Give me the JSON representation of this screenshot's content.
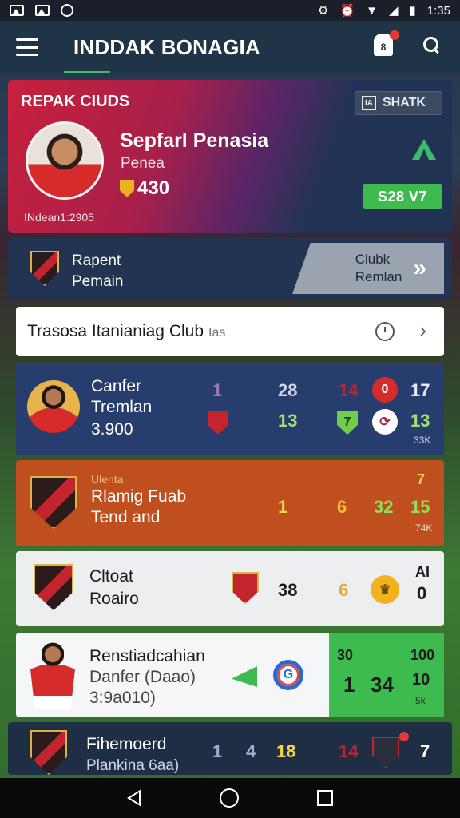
{
  "status_bar": {
    "time": "1:35"
  },
  "app_bar": {
    "title": "INDDAK BONAGIA"
  },
  "hero": {
    "league": "REPAK CIUDS",
    "chip_label": "SHATK",
    "player_name": "Sepfarl Penasia",
    "player_sub": "Penea",
    "points": "430",
    "id_text": "INdean1:2905",
    "badge": "S28 V7",
    "colors": {
      "accent_green": "#3dbb4f",
      "hero_red": "#c8203c"
    }
  },
  "club": {
    "name_line1": "Rapent",
    "name_line2": "Pemain",
    "link_line1": "Clubk",
    "link_line2": "Remlan"
  },
  "search": {
    "text": "Trasosa Itanianiag Club",
    "muted": "Ias"
  },
  "cards": {
    "blue": {
      "name_line1": "Canfer",
      "name_line2": "Tremlan",
      "value": "3.900",
      "n1": "1",
      "n2": "28",
      "n3": "13",
      "n4": "14",
      "n5": "0",
      "n6": "7",
      "n7": "17",
      "n8": "13",
      "n9": "33K"
    },
    "orange": {
      "tag": "Ulenta",
      "name_line1": "Rlamig Fuab",
      "name_line2": "Tend and",
      "n1": "1",
      "n2": "6",
      "n3": "32",
      "n4": "15",
      "top": "7",
      "small": "74K"
    },
    "grey": {
      "name_line1": "Cltoat",
      "name_line2": "Roairo",
      "n1": "38",
      "n2": "6",
      "n3": "AI",
      "n4": "0"
    },
    "white": {
      "name_line1": "Renstiadcahian",
      "name_line2": "Danfer (Daao)",
      "name_line3": "3:9a010)",
      "g1": "30",
      "g2": "1",
      "g3": "34",
      "g4": "100",
      "g5": "10",
      "g6": "5k"
    },
    "dark": {
      "name_line1": "Fihemoerd",
      "name_line2": "Plankina 6aa)",
      "n1": "1",
      "n2": "4",
      "n3": "18",
      "n4": "14",
      "n5": "7"
    }
  }
}
